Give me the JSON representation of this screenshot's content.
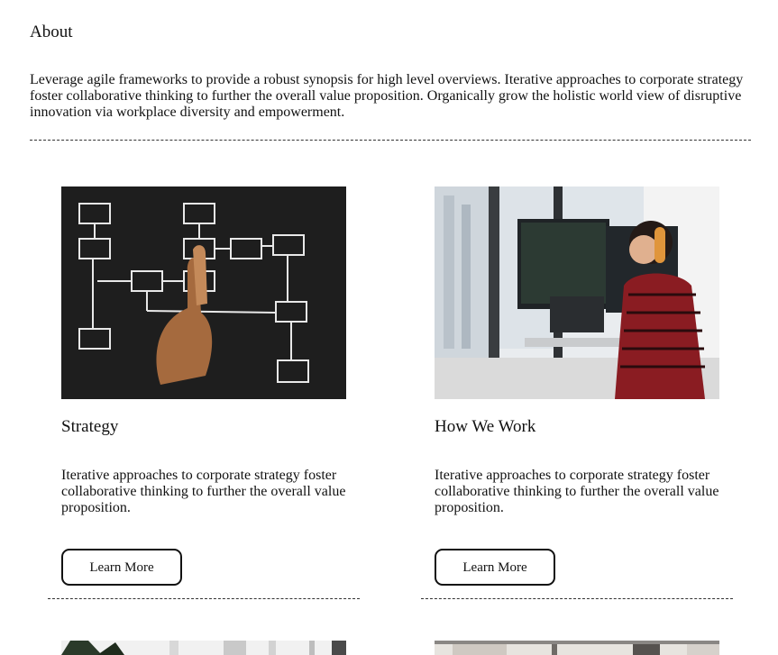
{
  "about": {
    "title": "About",
    "text": "Leverage agile frameworks to provide a robust synopsis for high level overviews. Iterative approaches to corporate strategy foster collaborative thinking to further the overall value proposition. Organically grow the holistic world view of disruptive innovation via workplace diversity and empowerment."
  },
  "cards": [
    {
      "title": "Strategy",
      "text": "Iterative approaches to corporate strategy foster collaborative thinking to further the overall value proposition.",
      "button_label": "Learn More",
      "image": "flowchart-chalkboard-photo"
    },
    {
      "title": "How We Work",
      "text": "Iterative approaches to corporate strategy foster collaborative thinking to further the overall value proposition.",
      "button_label": "Learn More",
      "image": "developer-at-desk-photo"
    }
  ],
  "colors": {
    "text": "#111111",
    "background": "#ffffff",
    "chalkboard": "#1e1e1e"
  }
}
